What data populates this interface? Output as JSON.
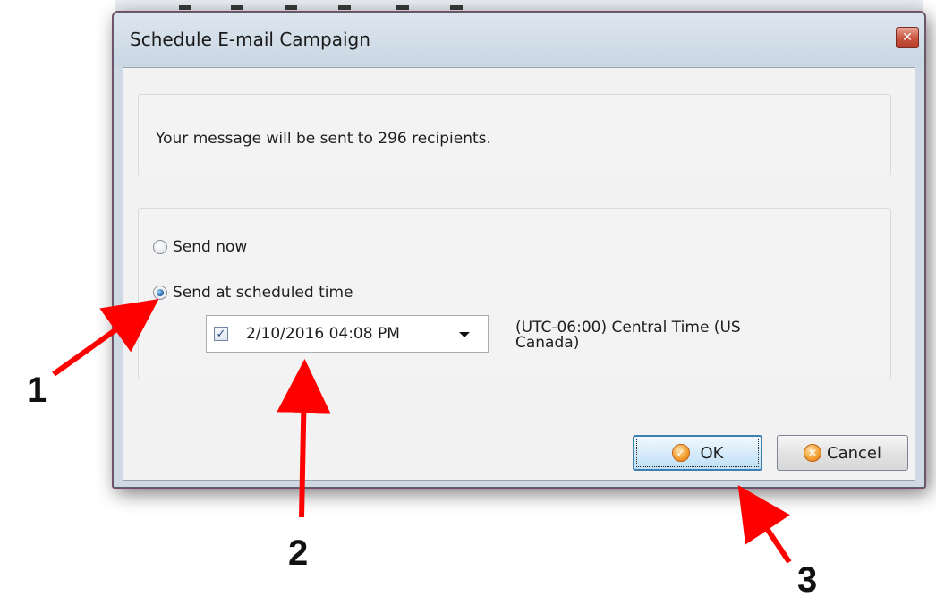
{
  "dialog": {
    "title": "Schedule E-mail Campaign",
    "close_glyph": "✕"
  },
  "message": {
    "text": "Your message will be sent to 296 recipients."
  },
  "schedule": {
    "send_now_label": "Send now",
    "send_scheduled_label": "Send at scheduled time",
    "selected_option": "Send at scheduled time",
    "datetime_enabled": true,
    "datetime_value": "2/10/2016 04:08 PM",
    "timezone_line1": "(UTC-06:00) Central Time (US",
    "timezone_line2": "Canada)"
  },
  "buttons": {
    "ok_label": "OK",
    "cancel_label": "Cancel"
  },
  "annotations": {
    "label_1": "1",
    "label_2": "2",
    "label_3": "3",
    "arrow_color": "#ff0000"
  },
  "icons": {
    "close": "close-icon",
    "ok": "ok-check-icon",
    "cancel": "cancel-x-icon",
    "dropdown": "chevron-down-icon"
  }
}
